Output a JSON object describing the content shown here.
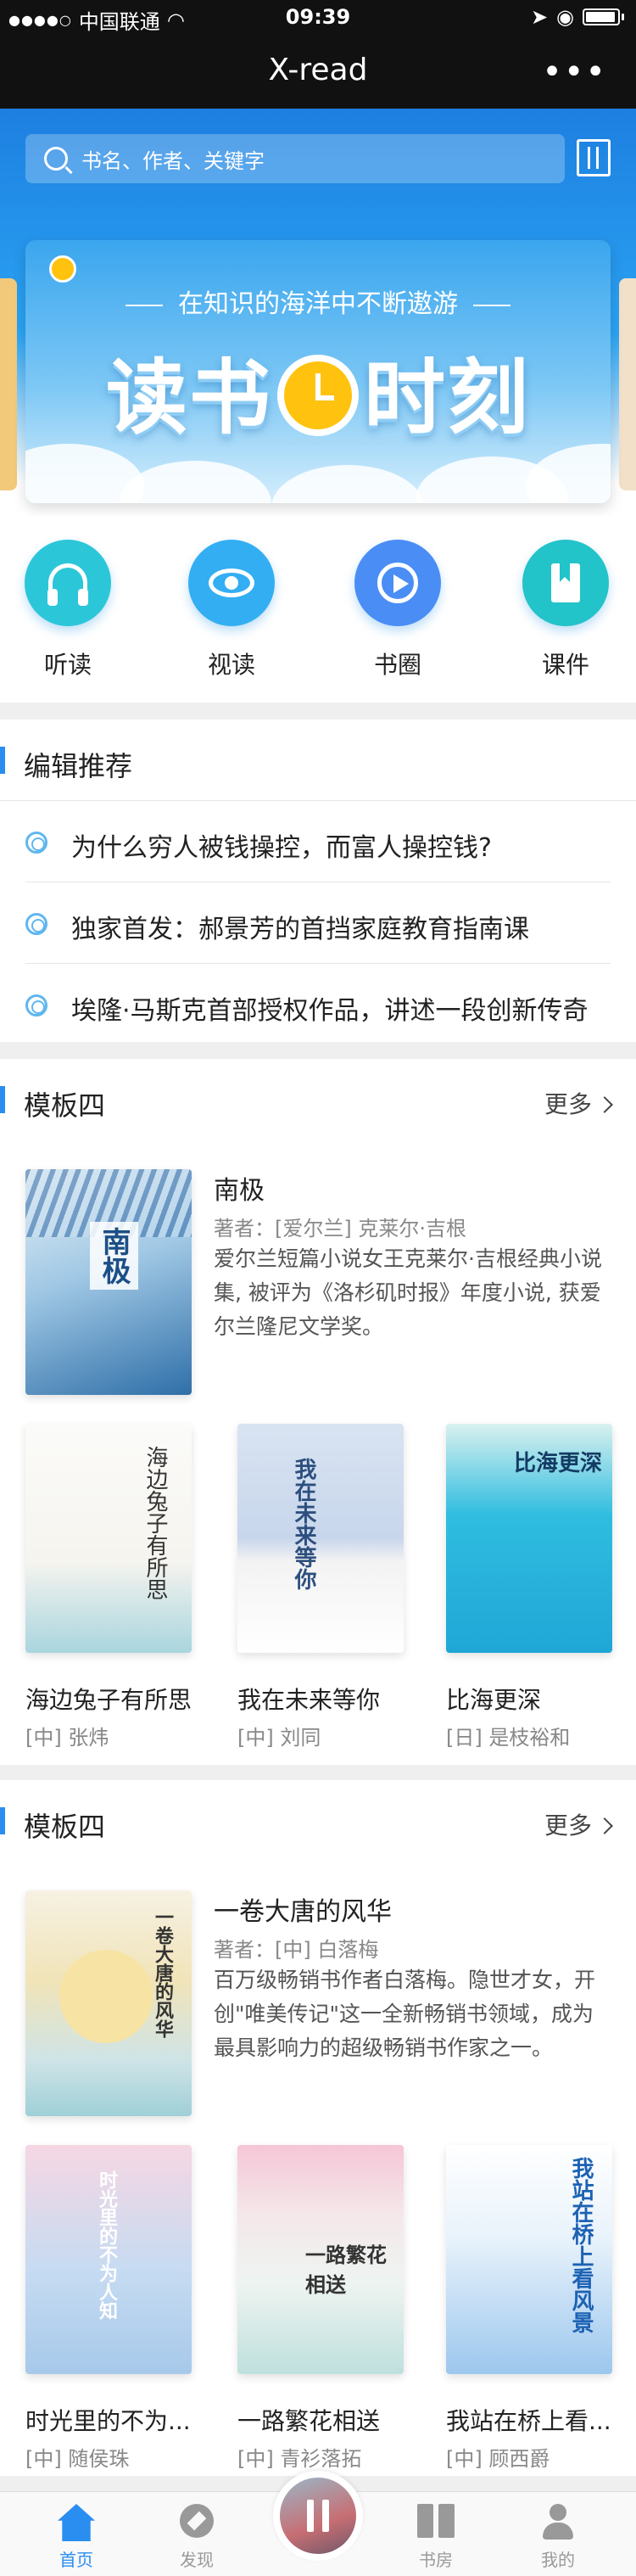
{
  "status": {
    "carrier": "中国联通",
    "time": "09:39"
  },
  "nav": {
    "title": "X-read",
    "more": "•••"
  },
  "search": {
    "placeholder": "书名、作者、关键字"
  },
  "banner": {
    "slogan": "在知识的海洋中不断遨游",
    "title_left": "读书",
    "title_right": "时刻"
  },
  "quick": [
    {
      "label": "听读",
      "icon": "headphones-icon",
      "color": "#2cc6d9"
    },
    {
      "label": "视读",
      "icon": "eye-icon",
      "color": "#34aef2"
    },
    {
      "label": "书圈",
      "icon": "play-icon",
      "color": "#4a8df5"
    },
    {
      "label": "课件",
      "icon": "bookmark-icon",
      "color": "#22c3c9"
    }
  ],
  "editor": {
    "title": "编辑推荐",
    "items": [
      "为什么穷人被钱操控，而富人操控钱?",
      "独家首发：郝景芳的首挡家庭教育指南课",
      "埃隆·马斯克首部授权作品，讲述一段创新传奇"
    ]
  },
  "modules": [
    {
      "title": "模板四",
      "more": "更多",
      "featured": {
        "name": "南极",
        "author": "著者：[爱尔兰] 克莱尔·吉根",
        "desc": "爱尔兰短篇小说女王克莱尔·吉根经典小说集, 被评为《洛杉矶时报》年度小说, 获爱尔兰隆尼文学奖。",
        "cover_text": "南极"
      },
      "books": [
        {
          "title": "海边兔子有所思",
          "author": "[中] 张炜",
          "cover_text": "海边兔子有所思"
        },
        {
          "title": "我在未来等你",
          "author": "[中] 刘同",
          "cover_text": "我在未来等你"
        },
        {
          "title": "比海更深",
          "author": "[日] 是枝裕和",
          "cover_text": "比海更深"
        }
      ]
    },
    {
      "title": "模板四",
      "more": "更多",
      "featured": {
        "name": "一卷大唐的风华",
        "author": "著者：[中] 白落梅",
        "desc": "百万级畅销书作者白落梅。隐世才女，开创\"唯美传记\"这一全新畅销书领域，成为最具影响力的超级畅销书作家之一。",
        "cover_text": "一卷大唐的风华"
      },
      "books": [
        {
          "title": "时光里的不为...",
          "author": "[中] 随侯珠",
          "cover_text": "时光里的不为人知"
        },
        {
          "title": "一路繁花相送",
          "author": "[中] 青衫落拓",
          "cover_text": "一路繁花相送"
        },
        {
          "title": "我站在桥上看...",
          "author": "[中] 顾西爵",
          "cover_text": "我站在桥上看风景"
        }
      ]
    }
  ],
  "tabs": [
    {
      "label": "首页",
      "active": true
    },
    {
      "label": "发现",
      "active": false
    },
    {
      "label": "书房",
      "active": false
    },
    {
      "label": "我的",
      "active": false
    }
  ]
}
